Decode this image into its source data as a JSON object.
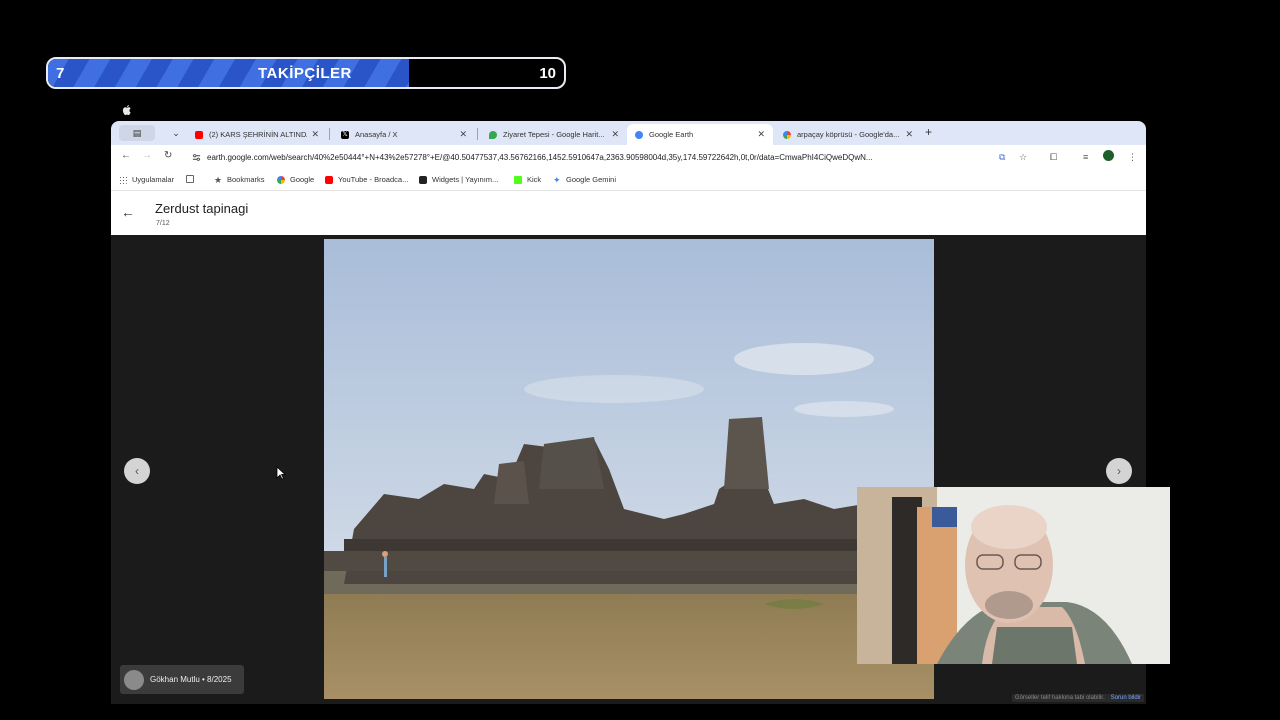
{
  "followers": {
    "title": "TAKİPÇİLER",
    "current": "7",
    "goal": "10",
    "progress": 0.7
  },
  "tabs": [
    {
      "label": "(2) KARS ŞEHRİNİN ALTINDA...",
      "favicon_color": "#ff0000",
      "favicon": "youtube-icon",
      "active": false
    },
    {
      "label": "Anasayfa / X",
      "favicon_color": "#000000",
      "favicon": "x-icon",
      "active": false
    },
    {
      "label": "Ziyaret Tepesi - Google Harit...",
      "favicon_color": "#34a853",
      "favicon": "maps-pin-icon",
      "active": false
    },
    {
      "label": "Google Earth",
      "favicon_color": "#4285f4",
      "favicon": "earth-icon",
      "active": true
    },
    {
      "label": "arpaçay köprüsü - Google'da...",
      "favicon_color": "#4285f4",
      "favicon": "google-icon",
      "active": false
    }
  ],
  "address_bar": {
    "url": "earth.google.com/web/search/40%2e50444°+N+43%2e57278°+E/@40.50477537,43.56762166,1452.5910647a,2363.90598004d,35y,174.59722642h,0t,0r/data=CmwaPhI4CiQweDQwN..."
  },
  "bookmarks": [
    {
      "label": "Uygulamalar",
      "icon": "apps-grid-icon"
    },
    {
      "label": "Bookmarks",
      "icon": "star-icon"
    },
    {
      "label": "Google",
      "icon": "google-icon"
    },
    {
      "label": "YouTube - Broadca...",
      "icon": "youtube-icon"
    },
    {
      "label": "Widgets | Yayınım...",
      "icon": "widgets-icon"
    },
    {
      "label": "Kick",
      "icon": "kick-icon"
    },
    {
      "label": "Google Gemini",
      "icon": "gemini-icon"
    }
  ],
  "place": {
    "title": "Zerdust tapinagi",
    "counter": "7/12"
  },
  "photo": {
    "attribution": "Gökhan Mutlu • 8/2025"
  },
  "footer": {
    "note": "Görseller telif hakkına tabi olabilir.",
    "link": "Sorun bildir"
  },
  "colors": {
    "follow_bar": "#3f6fe0",
    "tabstrip": "#dfe6f7",
    "viewer_bg": "#1b1b1b",
    "sky": "#b9c8dc"
  }
}
